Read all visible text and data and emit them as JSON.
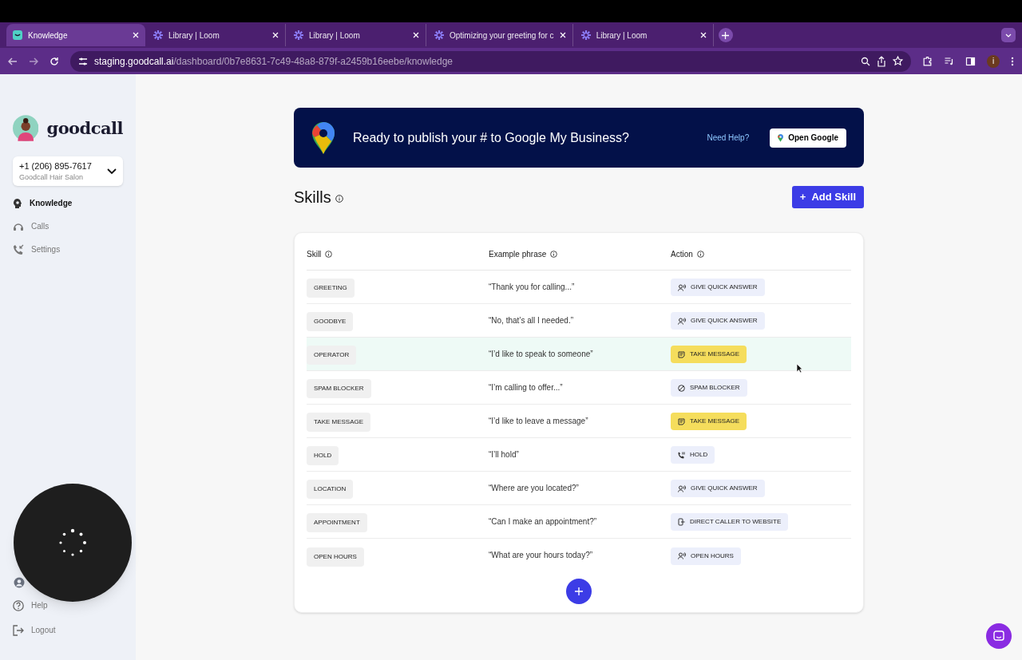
{
  "browser": {
    "tabs": [
      {
        "title": "Knowledge",
        "kind": "goodcall",
        "selected": true
      },
      {
        "title": "Library | Loom",
        "kind": "loom",
        "selected": false
      },
      {
        "title": "Library | Loom",
        "kind": "loom",
        "selected": false
      },
      {
        "title": "Optimizing your greeting for c",
        "kind": "loom",
        "selected": false
      },
      {
        "title": "Library | Loom",
        "kind": "loom",
        "selected": false
      }
    ],
    "url_host": "staging.goodcall.ai",
    "url_path": "/dashboard/0b7e8631-7c49-48a8-879f-a2459b16eebe/knowledge",
    "profile_initial": "i"
  },
  "sidebar": {
    "brand": "goodcall",
    "phone": "+1 (206) 895-7617",
    "business": "Goodcall Hair Salon",
    "items": [
      {
        "label": "Knowledge",
        "kind": "knowledge",
        "selected": true
      },
      {
        "label": "Calls",
        "kind": "calls",
        "selected": false
      },
      {
        "label": "Settings",
        "kind": "settings",
        "selected": false
      }
    ],
    "bottom_items": [
      {
        "label": "Help",
        "kind": "help"
      },
      {
        "label": "Logout",
        "kind": "logout"
      }
    ]
  },
  "banner": {
    "text": "Ready to publish your # to Google My Business?",
    "help_link": "Need Help?",
    "button": "Open Google"
  },
  "page_title": "Skills",
  "add_button_icon": "+",
  "add_button": "Add Skill",
  "table": {
    "columns": [
      "Skill",
      "Example phrase",
      "Action"
    ],
    "rows": [
      {
        "skill": "GREETING",
        "phrase": "“Thank you for calling...”",
        "action": "GIVE QUICK ANSWER",
        "kind": "quick_answer",
        "highlighted": false
      },
      {
        "skill": "GOODBYE",
        "phrase": "“No, that’s all I needed.”",
        "action": "GIVE QUICK ANSWER",
        "kind": "quick_answer",
        "highlighted": false
      },
      {
        "skill": "OPERATOR",
        "phrase": "“I’d like to speak to someone”",
        "action": "TAKE MESSAGE",
        "kind": "take_message",
        "highlighted": true
      },
      {
        "skill": "SPAM BLOCKER",
        "phrase": "“I’m calling to offer...”",
        "action": "SPAM BLOCKER",
        "kind": "spam",
        "highlighted": false
      },
      {
        "skill": "TAKE MESSAGE",
        "phrase": "“I’d like to leave a message”",
        "action": "TAKE MESSAGE",
        "kind": "take_message",
        "highlighted": false
      },
      {
        "skill": "HOLD",
        "phrase": "“I’ll hold”",
        "action": "HOLD",
        "kind": "hold",
        "highlighted": false
      },
      {
        "skill": "LOCATION",
        "phrase": "“Where are you located?”",
        "action": "GIVE QUICK ANSWER",
        "kind": "quick_answer",
        "highlighted": false
      },
      {
        "skill": "APPOINTMENT",
        "phrase": "“Can I make an appointment?”",
        "action": "DIRECT CALLER TO WEBSITE",
        "kind": "website",
        "highlighted": false
      },
      {
        "skill": "OPEN HOURS",
        "phrase": "“What are your hours today?”",
        "action": "OPEN HOURS",
        "kind": "quick_answer",
        "highlighted": false
      }
    ]
  }
}
